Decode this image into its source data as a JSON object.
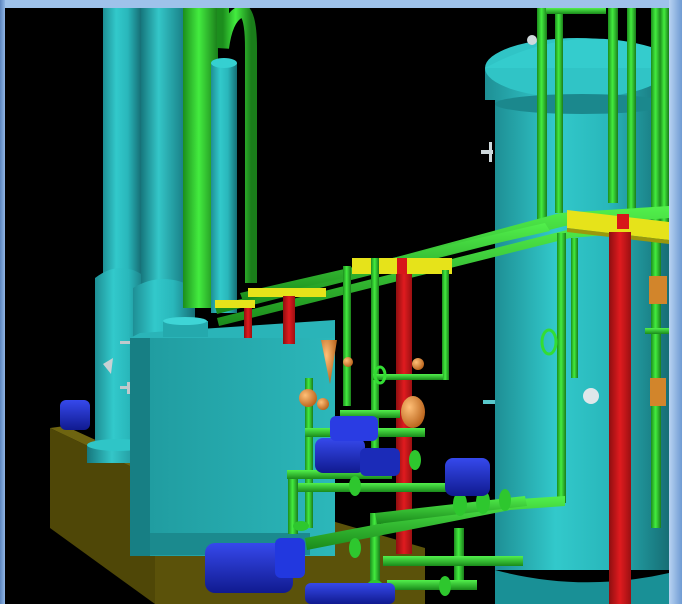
{
  "viewer": {
    "scene": "3d-plant-model",
    "background_color": "#000000",
    "frame_color": "#7aa7dc",
    "colors": {
      "vessel": "#29b9bc",
      "vessel_shade": "#178c91",
      "pipe_green": "#2fd12f",
      "support_red": "#d7161a",
      "support_yellow": "#e2df16",
      "pump_blue": "#1d2fd0",
      "valve_orange": "#e38b2c",
      "base_olive": "#5d5408"
    }
  }
}
